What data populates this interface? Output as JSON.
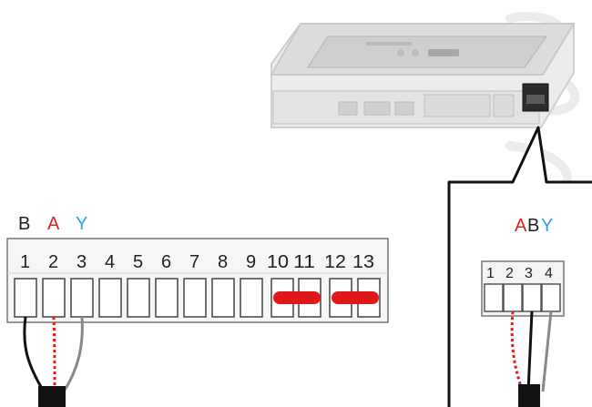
{
  "left_strip": {
    "labels": [
      {
        "text": "B",
        "color": "#222222"
      },
      {
        "text": "A",
        "color": "#e02020"
      },
      {
        "text": "Y",
        "color": "#2aa6dc"
      }
    ],
    "terminals": [
      "1",
      "2",
      "3",
      "4",
      "5",
      "6",
      "7",
      "8",
      "9",
      "10",
      "11",
      "12",
      "13"
    ]
  },
  "callout": {
    "labels": [
      {
        "text": "A",
        "color": "#e02020"
      },
      {
        "text": "B",
        "color": "#222222"
      },
      {
        "text": "Y",
        "color": "#2aa6dc"
      }
    ],
    "terminals": [
      "1",
      "2",
      "3",
      "4"
    ]
  },
  "colors": {
    "wire_red": "#d81e1e",
    "wire_black": "#111111",
    "wire_grey": "#888888",
    "jumper": "#e01818",
    "device_body": "#e9e9e9"
  }
}
